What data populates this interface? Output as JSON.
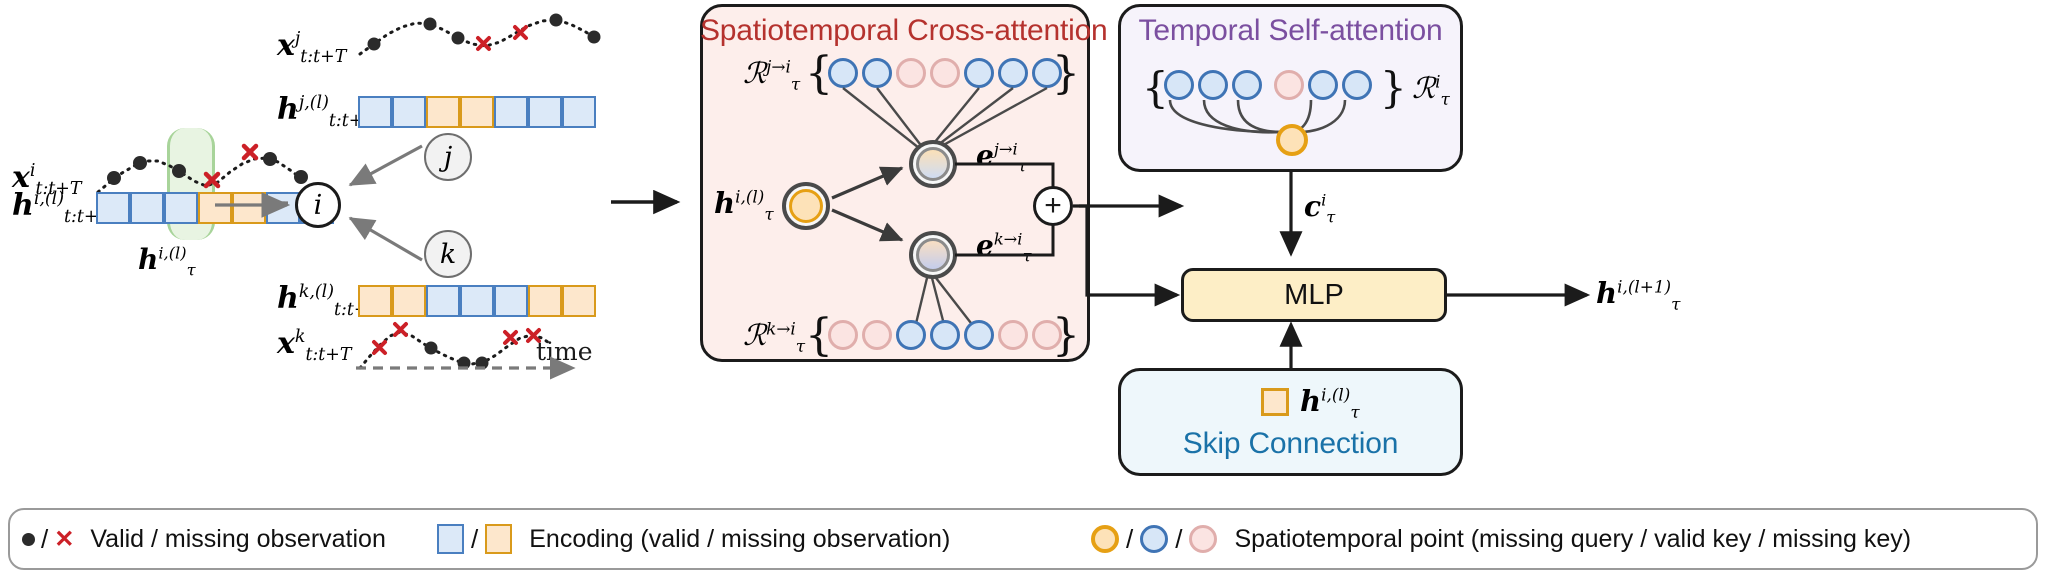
{
  "figure": {
    "kind": "model-architecture-diagram",
    "panels": {
      "cross_attention": {
        "title": "Spatiotemporal Cross-attention",
        "accent": "#b5322e",
        "bg": "#fdeeeb"
      },
      "self_attention": {
        "title": "Temporal Self-attention",
        "accent": "#7b4fa0",
        "bg": "#f6f3fb"
      },
      "skip_connection": {
        "title": "Skip Connection",
        "accent": "#1a72a8",
        "bg": "#eef7fb"
      },
      "mlp": {
        "label": "MLP",
        "bg": "#fdeec6"
      }
    }
  },
  "left": {
    "series": [
      {
        "name": "x_j",
        "base": "x",
        "sup": "j",
        "sub": "t:t+T"
      },
      {
        "name": "h_j",
        "base": "h",
        "sup": "j,(l)",
        "sub": "t:t+T"
      },
      {
        "name": "x_i",
        "base": "x",
        "sup": "i",
        "sub": "t:t+T"
      },
      {
        "name": "h_i",
        "base": "h",
        "sup": "i,(l)",
        "sub": "t:t+T"
      },
      {
        "name": "h_i_tau",
        "base": "h",
        "sup": "i,(l)",
        "sub": "τ"
      },
      {
        "name": "h_k",
        "base": "h",
        "sup": "k,(l)",
        "sub": "t:t+T"
      },
      {
        "name": "x_k",
        "base": "x",
        "sup": "k",
        "sub": "t:t+T"
      }
    ],
    "graph_nodes": [
      "i",
      "j",
      "k"
    ],
    "time_axis_label": "time",
    "encodings": {
      "h_j_cells": [
        "blue",
        "blue",
        "orange",
        "orange",
        "blue",
        "blue",
        "blue"
      ],
      "h_i_cells": [
        "blue",
        "blue",
        "blue",
        "orange",
        "orange",
        "blue",
        "blue"
      ],
      "h_k_cells": [
        "orange",
        "orange",
        "blue",
        "blue",
        "blue",
        "orange",
        "orange"
      ]
    }
  },
  "cross": {
    "top_set_label": {
      "base": "R",
      "sup": "j→i",
      "sub": "τ"
    },
    "bottom_set_label": {
      "base": "R",
      "sup": "k→i",
      "sub": "τ"
    },
    "brace_open": "{",
    "brace_close": "}",
    "top_nodes": [
      "blue",
      "blue",
      "pink",
      "pink",
      "blue",
      "blue",
      "blue"
    ],
    "bottom_nodes": [
      "pink",
      "pink",
      "blue",
      "blue",
      "blue",
      "pink",
      "pink"
    ],
    "query_label": {
      "base": "h",
      "sup": "i,(l)",
      "sub": "τ"
    },
    "msg_top_label": {
      "base": "e",
      "sup": "j→i",
      "sub": "τ"
    },
    "msg_bottom_label": {
      "base": "e",
      "sup": "k→i",
      "sub": "τ"
    },
    "sum_symbol": "+"
  },
  "self": {
    "set_label": {
      "base": "R",
      "sup": "i",
      "sub": "τ"
    },
    "brace_open": "{",
    "brace_close": "}",
    "nodes": [
      "blue",
      "blue",
      "blue",
      "pink",
      "blue",
      "blue"
    ],
    "center_node": "orange",
    "output_label": {
      "base": "c",
      "sup": "i",
      "sub": "τ"
    }
  },
  "skip": {
    "label": {
      "base": "h",
      "sup": "i,(l)",
      "sub": "τ"
    },
    "swatch": "orange"
  },
  "output": {
    "label": {
      "base": "h",
      "sup": "i,(l+1)",
      "sub": "τ"
    }
  },
  "legend": {
    "items": [
      {
        "name": "valid-missing-observation",
        "symbols": [
          "●",
          "/",
          "✕"
        ],
        "text": "Valid / missing observation"
      },
      {
        "name": "encoding",
        "symbols": [
          "blue-square",
          "/",
          "orange-square"
        ],
        "text": "Encoding (valid / missing observation)"
      },
      {
        "name": "spatiotemporal-point",
        "symbols": [
          "orange-circle",
          "/",
          "blue-circle",
          "/",
          "pink-circle"
        ],
        "text": "Spatiotemporal point (missing query / valid key / missing key)"
      }
    ],
    "separator": "/",
    "t1": "Valid / missing observation",
    "t2": "Encoding (valid / missing observation)",
    "t3": "Spatiotemporal point (missing query / valid key / missing key)"
  },
  "colors": {
    "valid_blue_fill": "#d7e6f7",
    "valid_blue_stroke": "#3f74b5",
    "missing_pink_fill": "#fbe4e2",
    "missing_pink_stroke": "#e0aeac",
    "missing_orange_fill": "#fde2b8",
    "missing_orange_stroke": "#e6a014",
    "cross_title": "#b5322e",
    "self_title": "#7b4fa0",
    "skip_title": "#1a72a8",
    "x_red": "#cc2027"
  }
}
